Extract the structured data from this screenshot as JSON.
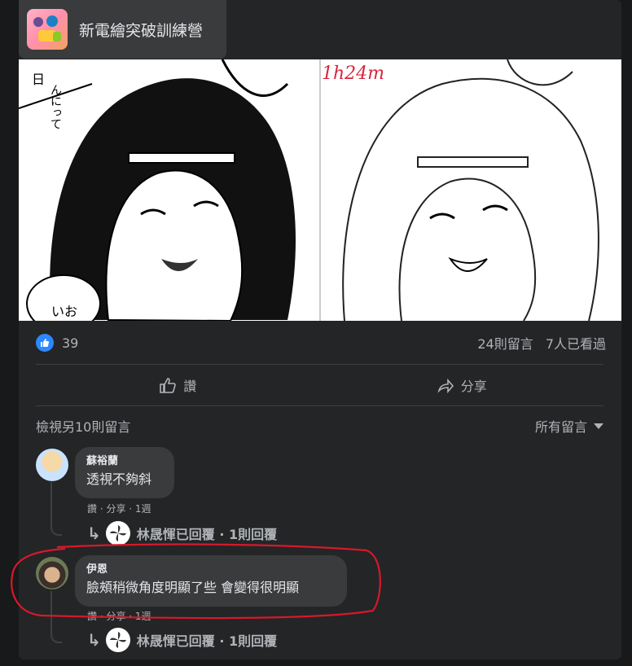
{
  "group": {
    "name": "新電繪突破訓練營"
  },
  "post": {
    "image_caption_timer": "1h24m",
    "manga_left_text": [
      "日",
      "んにって",
      "いお"
    ]
  },
  "reactions": {
    "like_count": "39",
    "comments_count": "24則留言",
    "views": "7人已看過"
  },
  "actions": {
    "like_label": "讚",
    "share_label": "分享"
  },
  "comments_header": {
    "view_more": "檢視另10則留言",
    "sort_label": "所有留言"
  },
  "comments": [
    {
      "author": "蘇裕蘭",
      "text": "透視不夠斜",
      "meta": "讚 · 分享 · 1週",
      "reply_summary": "林晟惲已回覆 · 1則回覆"
    },
    {
      "author": "伊恩",
      "text": "臉頰稍微角度明顯了些 會變得很明顯",
      "meta": "讚 · 分享 · 1週",
      "reply_summary": "林晟惲已回覆 · 1則回覆"
    }
  ],
  "colors": {
    "accent": "#2d88ff",
    "highlight_red": "#d7192a",
    "card_bg": "#242526"
  }
}
